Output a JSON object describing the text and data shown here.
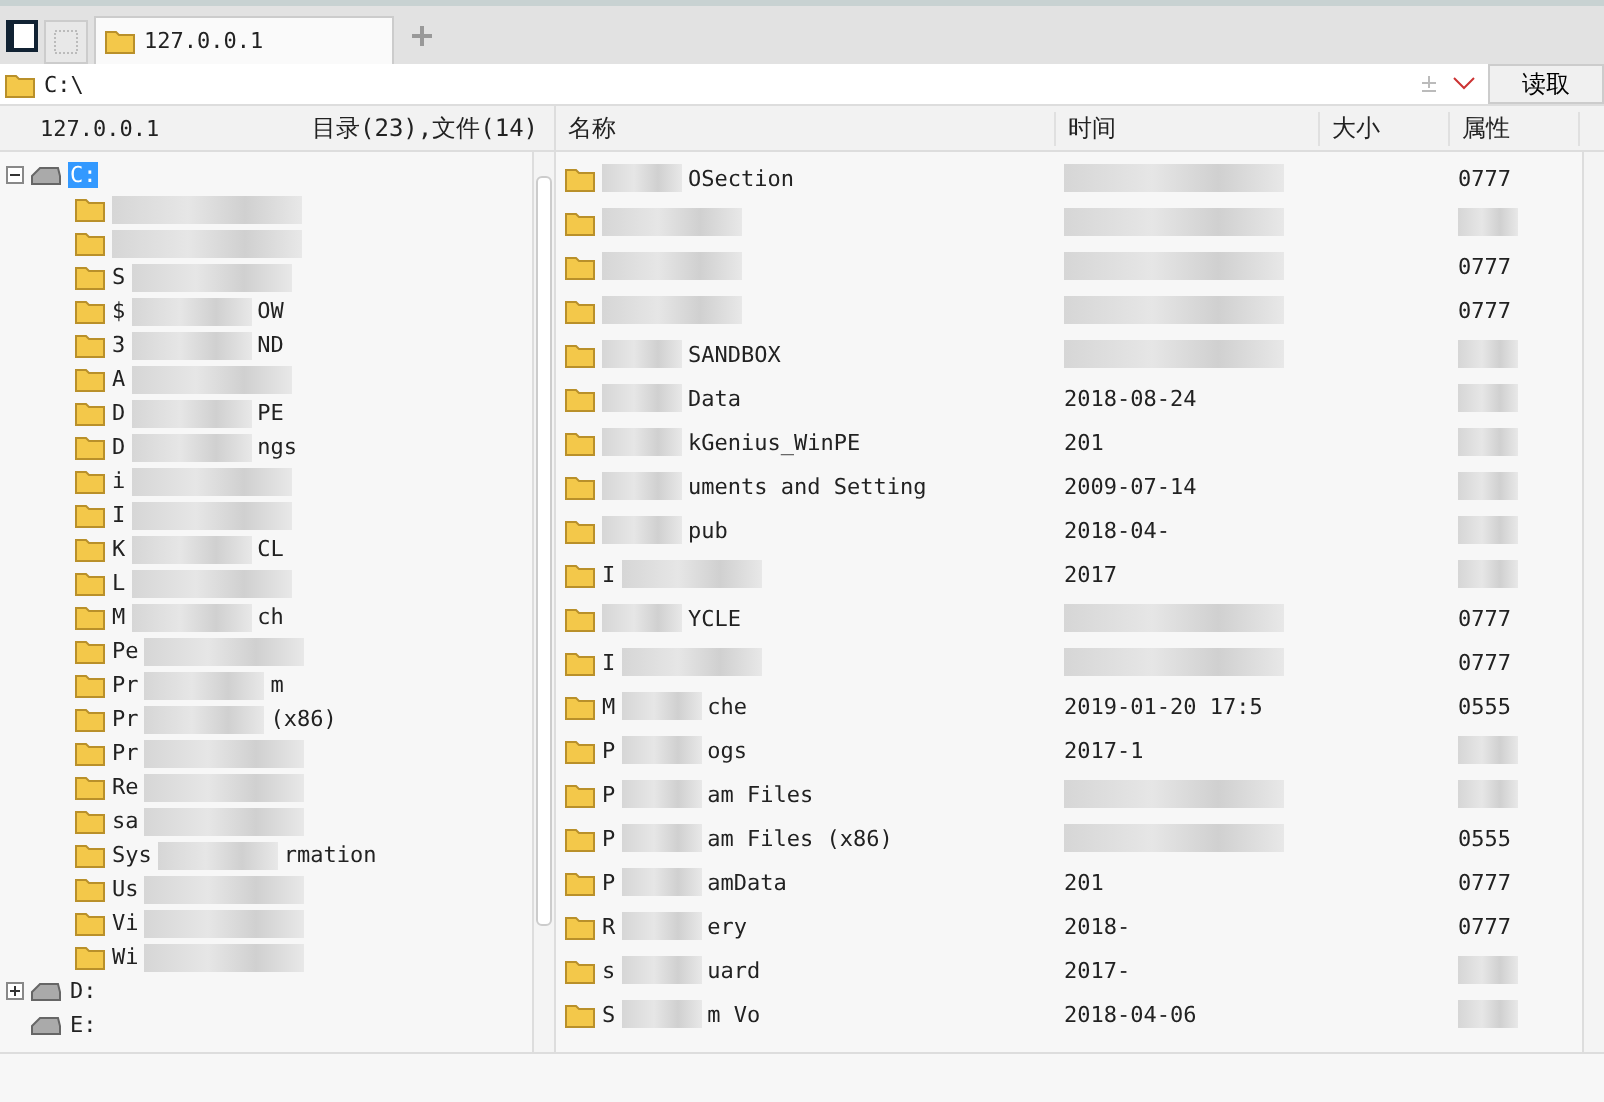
{
  "tabs": [
    {
      "label": "127.0.0.1",
      "selected": true
    }
  ],
  "address": {
    "value": "C:\\",
    "button": "读取"
  },
  "left_header": {
    "host": "127.0.0.1",
    "summary": "目录(23),文件(14)"
  },
  "tree": [
    {
      "label": "C:",
      "selected": true,
      "expanded": true,
      "children": [
        {
          "kind": "redacted"
        },
        {
          "kind": "redacted"
        },
        {
          "head": "S"
        },
        {
          "head": "$",
          "tail": "OW"
        },
        {
          "head": "3",
          "tail": "ND"
        },
        {
          "head": "A"
        },
        {
          "head": "D",
          "tail": "PE"
        },
        {
          "head": "D",
          "tail": "ngs"
        },
        {
          "head": "i"
        },
        {
          "head": "I"
        },
        {
          "head": "K",
          "tail": "CL"
        },
        {
          "head": "L"
        },
        {
          "head": "M",
          "tail": "ch"
        },
        {
          "head": "Pe"
        },
        {
          "head": "Pr",
          "tail": "m"
        },
        {
          "head": "Pr",
          "tail": "(x86)"
        },
        {
          "head": "Pr"
        },
        {
          "head": "Re"
        },
        {
          "head": "sa"
        },
        {
          "head": "Sys",
          "tail": "rmation"
        },
        {
          "head": "Us"
        },
        {
          "head": "Vi"
        },
        {
          "head": "Wi"
        }
      ]
    },
    {
      "label": "D:",
      "selected": false,
      "expanded": false
    },
    {
      "label": "E:",
      "selected": false
    }
  ],
  "table": {
    "columns": [
      "名称",
      "时间",
      "大小",
      "属性"
    ],
    "rows": [
      {
        "tail": "OSection",
        "attr": "0777"
      },
      {},
      {
        "attr": "0777"
      },
      {
        "attr": "0777"
      },
      {
        "tail": "SANDBOX"
      },
      {
        "tail": "Data",
        "time": "2018-08-24"
      },
      {
        "tail": "kGenius_WinPE",
        "time": "201"
      },
      {
        "tail": "uments and Setting",
        "time": "2009-07-14"
      },
      {
        "tail": "pub",
        "time": "2018-04-"
      },
      {
        "head": "I",
        "time": "2017"
      },
      {
        "tail": "YCLE",
        "attr": "0777"
      },
      {
        "head": "I",
        "attr": "0777"
      },
      {
        "head": "M",
        "tail": "che",
        "time": "2019-01-20 17:5",
        "attr": "0555"
      },
      {
        "head": "P",
        "tail": "ogs",
        "time": "2017-1"
      },
      {
        "head": "P",
        "tail": "am Files"
      },
      {
        "head": "P",
        "tail": "am Files (x86)",
        "attr": "0555"
      },
      {
        "head": "P",
        "tail": "amData",
        "time": "201",
        "attr": "0777"
      },
      {
        "head": "R",
        "tail": "ery",
        "time": "2018-",
        "attr": "0777"
      },
      {
        "head": "s",
        "tail": "uard",
        "time": "2017-"
      },
      {
        "head": "S",
        "tail": "m Vo",
        "time": "2018-04-06"
      }
    ]
  }
}
